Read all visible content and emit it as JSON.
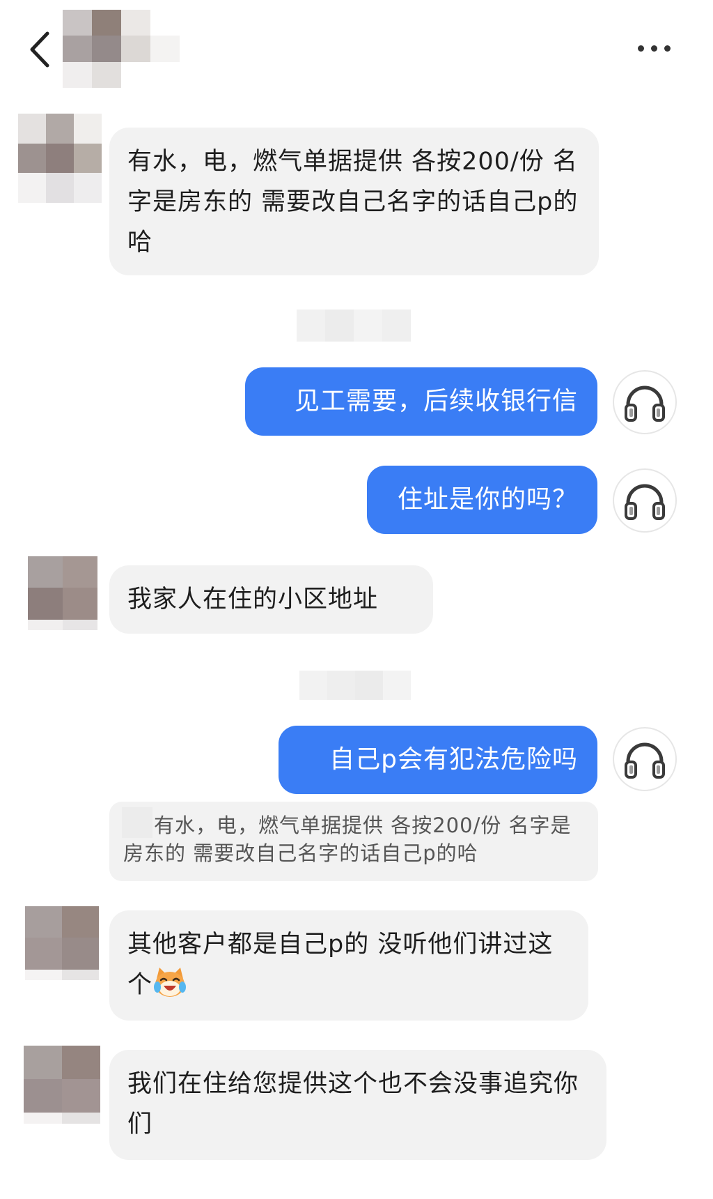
{
  "header": {
    "back_icon": "chevron-left-icon",
    "more_icon": "more-dots-icon"
  },
  "messages": [
    {
      "side": "in",
      "text": "有水，电，燃气单据提供 各按200/份  名字是房东的 需要改自己名字的话自己p的哈"
    },
    {
      "side": "out",
      "text": "见工需要，后续收银行信",
      "avatar_icon": "headphones-icon"
    },
    {
      "side": "out",
      "text": "住址是你的吗？",
      "avatar_icon": "headphones-icon"
    },
    {
      "side": "in",
      "text": "我家人在住的小区地址"
    },
    {
      "side": "out",
      "text": "自己p会有犯法危险吗",
      "avatar_icon": "headphones-icon"
    },
    {
      "side": "quote",
      "text": "有水，电，燃气单据提供 各按200/份  名字是房东的 需要改自己名字的话自己p的哈"
    },
    {
      "side": "in",
      "text": "其他客户都是自己p的  没听他们讲过这个",
      "emoji": "crying-laughing-cat-emoji"
    },
    {
      "side": "in",
      "text": "我们在住给您提供这个也不会没事追究你们"
    }
  ],
  "colors": {
    "outgoing_bubble": "#3a7df5",
    "incoming_bubble": "#f2f2f2",
    "background": "#ffffff"
  }
}
